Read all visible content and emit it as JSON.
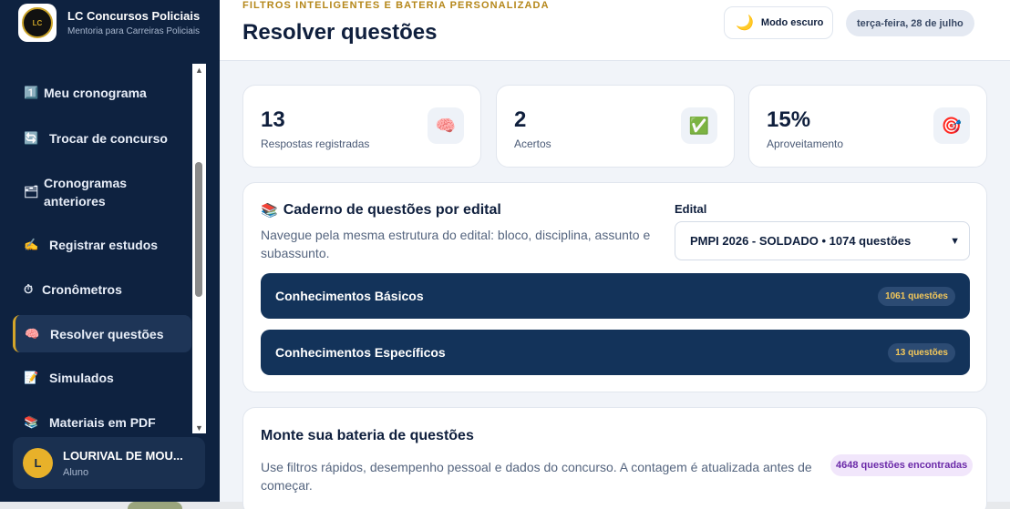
{
  "brand": {
    "title": "LC Concursos Policiais",
    "subtitle": "Mentoria para Carreiras Policiais",
    "logo_text": "LC"
  },
  "sidebar": {
    "items": [
      {
        "icon": "1️⃣",
        "label": "Meu cronograma"
      },
      {
        "icon": "🔄",
        "label": "Trocar de concurso"
      },
      {
        "icon": "🗂",
        "label": "Cronogramas anteriores"
      },
      {
        "icon": "✍️",
        "label": "Registrar estudos"
      },
      {
        "icon": "⏱",
        "label": "Cronômetros"
      },
      {
        "icon": "🧠",
        "label": "Resolver questões",
        "active": true
      },
      {
        "icon": "📝",
        "label": "Simulados"
      },
      {
        "icon": "📚",
        "label": "Materiais em PDF"
      }
    ]
  },
  "user": {
    "initial": "L",
    "name": "LOURIVAL DE MOU...",
    "role": "Aluno"
  },
  "header": {
    "eyebrow": "FILTROS INTELIGENTES E BATERIA PERSONALIZADA",
    "title": "Resolver questões",
    "dark_mode_label": "Modo escuro",
    "date": "terça-feira, 28 de julho"
  },
  "stats": [
    {
      "value": "13",
      "label": "Respostas registradas",
      "icon": "🧠"
    },
    {
      "value": "2",
      "label": "Acertos",
      "icon": "✅"
    },
    {
      "value": "15%",
      "label": "Aproveitamento",
      "icon": "🎯"
    }
  ],
  "caderno": {
    "title": "Caderno de questões por edital",
    "description": "Navegue pela mesma estrutura do edital: bloco, disciplina, assunto e subassunto.",
    "edital_label": "Edital",
    "edital_selected": "PMPI 2026 - SOLDADO • 1074 questões",
    "blocks": [
      {
        "label": "Conhecimentos Básicos",
        "badge": "1061 questões"
      },
      {
        "label": "Conhecimentos Específicos",
        "badge": "13 questões"
      }
    ]
  },
  "bateria": {
    "title": "Monte sua bateria de questões",
    "description": "Use filtros rápidos, desempenho pessoal e dados do concurso. A contagem é atualizada antes de começar.",
    "count_badge": "4648 questões encontradas"
  },
  "colors": {
    "sidebar": "#0e2240",
    "accent": "#d4a52a",
    "block": "#13335a",
    "badge_purple": "#6b2aa8"
  }
}
